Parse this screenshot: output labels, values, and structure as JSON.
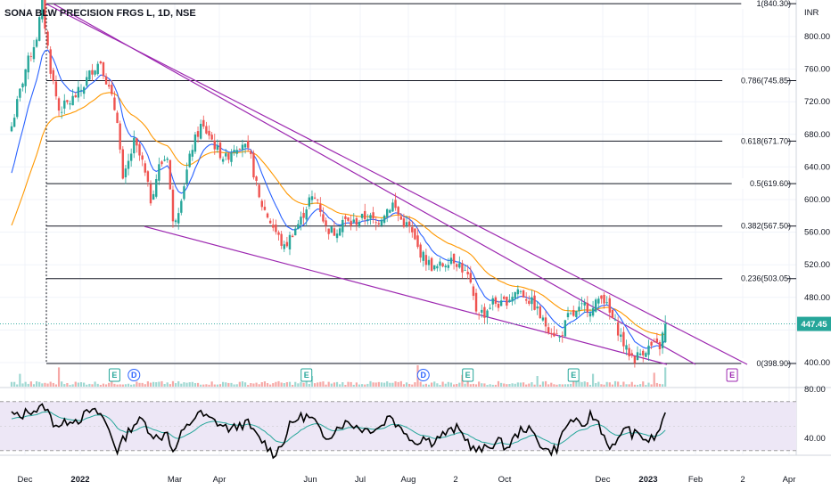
{
  "title": "SONA BLW PRECISION FRGS L, 1D, NSE",
  "currency": "INR",
  "colors": {
    "up": "#26a69a",
    "down": "#ef5350",
    "fib": "#131722",
    "trend": "#9c27b0",
    "ema_fast": "#2962ff",
    "ema_slow": "#ff9800",
    "rsi_line": "#000000",
    "rsi_ma": "#26a69a",
    "rsi_band": "#ede7f6",
    "price_tag": "#26a69a",
    "earnings": "#26a69a",
    "dividend": "#2962ff",
    "future_earnings": "#9c27b0"
  },
  "chart_data": {
    "type": "candlestick",
    "ylim": [
      385,
      845
    ],
    "y_ticks": [
      "800.00",
      "760.00",
      "720.00",
      "680.00",
      "640.00",
      "600.00",
      "560.00",
      "520.00",
      "480.00",
      "440.00",
      "400.00"
    ],
    "x_labels": [
      "Dec",
      "2022",
      "Mar",
      "Apr",
      "Jun",
      "Jul",
      "Aug",
      "2",
      "Oct",
      "Dec",
      "2023",
      "Feb",
      "2",
      "Apr"
    ],
    "x_label_bold": [
      "2022",
      "2023"
    ],
    "fib_levels": [
      {
        "ratio": "1",
        "price": 840.3,
        "label": "1(840.30)"
      },
      {
        "ratio": "0.786",
        "price": 745.85,
        "label": "0.786(745.85)"
      },
      {
        "ratio": "0.618",
        "price": 671.7,
        "label": "0.618(671.70)"
      },
      {
        "ratio": "0.5",
        "price": 619.6,
        "label": "0.5(619.60)"
      },
      {
        "ratio": "0.382",
        "price": 567.5,
        "label": "0.382(567.50)"
      },
      {
        "ratio": "0.236",
        "price": 503.05,
        "label": "0.236(503.05)"
      },
      {
        "ratio": "0",
        "price": 398.9,
        "label": "0(398.90)"
      }
    ],
    "last_price": 447.45,
    "last_price_label": "447.45",
    "anchors": [
      [
        0,
        690
      ],
      [
        5,
        760
      ],
      [
        9,
        800
      ],
      [
        11,
        840
      ],
      [
        14,
        760
      ],
      [
        17,
        710
      ],
      [
        21,
        720
      ],
      [
        25,
        735
      ],
      [
        29,
        760
      ],
      [
        32,
        770
      ],
      [
        35,
        735
      ],
      [
        38,
        700
      ],
      [
        40,
        620
      ],
      [
        44,
        670
      ],
      [
        47,
        645
      ],
      [
        50,
        600
      ],
      [
        53,
        640
      ],
      [
        56,
        655
      ],
      [
        58,
        570
      ],
      [
        60,
        590
      ],
      [
        62,
        620
      ],
      [
        65,
        665
      ],
      [
        68,
        690
      ],
      [
        71,
        680
      ],
      [
        74,
        660
      ],
      [
        77,
        650
      ],
      [
        80,
        665
      ],
      [
        83,
        670
      ],
      [
        86,
        650
      ],
      [
        89,
        600
      ],
      [
        92,
        580
      ],
      [
        95,
        560
      ],
      [
        98,
        540
      ],
      [
        101,
        560
      ],
      [
        104,
        575
      ],
      [
        107,
        600
      ],
      [
        110,
        600
      ],
      [
        113,
        565
      ],
      [
        116,
        560
      ],
      [
        119,
        575
      ],
      [
        122,
        570
      ],
      [
        125,
        575
      ],
      [
        128,
        580
      ],
      [
        131,
        570
      ],
      [
        134,
        585
      ],
      [
        137,
        595
      ],
      [
        140,
        575
      ],
      [
        143,
        565
      ],
      [
        146,
        540
      ],
      [
        149,
        525
      ],
      [
        152,
        515
      ],
      [
        155,
        520
      ],
      [
        158,
        530
      ],
      [
        161,
        520
      ],
      [
        164,
        505
      ],
      [
        167,
        465
      ],
      [
        170,
        460
      ],
      [
        173,
        475
      ],
      [
        176,
        470
      ],
      [
        179,
        480
      ],
      [
        182,
        490
      ],
      [
        185,
        480
      ],
      [
        188,
        470
      ],
      [
        191,
        450
      ],
      [
        194,
        440
      ],
      [
        197,
        430
      ],
      [
        200,
        455
      ],
      [
        203,
        460
      ],
      [
        206,
        470
      ],
      [
        209,
        465
      ],
      [
        212,
        485
      ],
      [
        215,
        460
      ],
      [
        218,
        440
      ],
      [
        221,
        415
      ],
      [
        224,
        405
      ],
      [
        227,
        415
      ],
      [
        230,
        420
      ],
      [
        233,
        420
      ],
      [
        235,
        447.45
      ]
    ],
    "volume_spikes": [
      [
        3,
        0.6
      ],
      [
        17,
        0.9
      ],
      [
        108,
        0.5
      ],
      [
        146,
        1.0
      ],
      [
        162,
        0.55
      ],
      [
        189,
        0.5
      ],
      [
        209,
        0.6
      ],
      [
        231,
        0.65
      ],
      [
        235,
        0.9
      ]
    ],
    "rsi": {
      "ticks": [
        "80.00",
        "40.00"
      ],
      "ylim": [
        22,
        84
      ],
      "overbought": 70,
      "oversold": 30,
      "anchors": [
        [
          0,
          60
        ],
        [
          3,
          57
        ],
        [
          6,
          63
        ],
        [
          9,
          63
        ],
        [
          12,
          66
        ],
        [
          15,
          53
        ],
        [
          18,
          50
        ],
        [
          21,
          56
        ],
        [
          24,
          55
        ],
        [
          28,
          62
        ],
        [
          32,
          60
        ],
        [
          35,
          47
        ],
        [
          38,
          30
        ],
        [
          41,
          42
        ],
        [
          44,
          52
        ],
        [
          47,
          55
        ],
        [
          50,
          45
        ],
        [
          53,
          39
        ],
        [
          56,
          47
        ],
        [
          58,
          27
        ],
        [
          61,
          43
        ],
        [
          64,
          52
        ],
        [
          67,
          61
        ],
        [
          70,
          57
        ],
        [
          73,
          54
        ],
        [
          76,
          50
        ],
        [
          79,
          47
        ],
        [
          82,
          51
        ],
        [
          85,
          52
        ],
        [
          88,
          42
        ],
        [
          91,
          36
        ],
        [
          94,
          27
        ],
        [
          97,
          34
        ],
        [
          100,
          50
        ],
        [
          103,
          57
        ],
        [
          106,
          58
        ],
        [
          109,
          54
        ],
        [
          112,
          40
        ],
        [
          115,
          44
        ],
        [
          118,
          51
        ],
        [
          121,
          53
        ],
        [
          124,
          50
        ],
        [
          127,
          47
        ],
        [
          130,
          48
        ],
        [
          133,
          50
        ],
        [
          136,
          60
        ],
        [
          139,
          49
        ],
        [
          142,
          45
        ],
        [
          145,
          36
        ],
        [
          148,
          41
        ],
        [
          151,
          37
        ],
        [
          154,
          42
        ],
        [
          157,
          45
        ],
        [
          160,
          48
        ],
        [
          163,
          41
        ],
        [
          166,
          31
        ],
        [
          169,
          30
        ],
        [
          172,
          34
        ],
        [
          175,
          38
        ],
        [
          178,
          32
        ],
        [
          181,
          41
        ],
        [
          184,
          49
        ],
        [
          187,
          45
        ],
        [
          190,
          36
        ],
        [
          193,
          29
        ],
        [
          196,
          32
        ],
        [
          199,
          49
        ],
        [
          202,
          56
        ],
        [
          205,
          47
        ],
        [
          208,
          59
        ],
        [
          211,
          53
        ],
        [
          214,
          36
        ],
        [
          217,
          32
        ],
        [
          220,
          50
        ],
        [
          223,
          44
        ],
        [
          226,
          42
        ],
        [
          229,
          38
        ],
        [
          232,
          42
        ],
        [
          235,
          61
        ]
      ]
    },
    "events": [
      {
        "type": "E",
        "bar": 37
      },
      {
        "type": "D",
        "bar": 44
      },
      {
        "type": "E",
        "bar": 106
      },
      {
        "type": "D",
        "bar": 148
      },
      {
        "type": "E",
        "bar": 164
      },
      {
        "type": "E",
        "bar": 202
      },
      {
        "type": "E",
        "bar": 259,
        "future": true
      }
    ]
  }
}
